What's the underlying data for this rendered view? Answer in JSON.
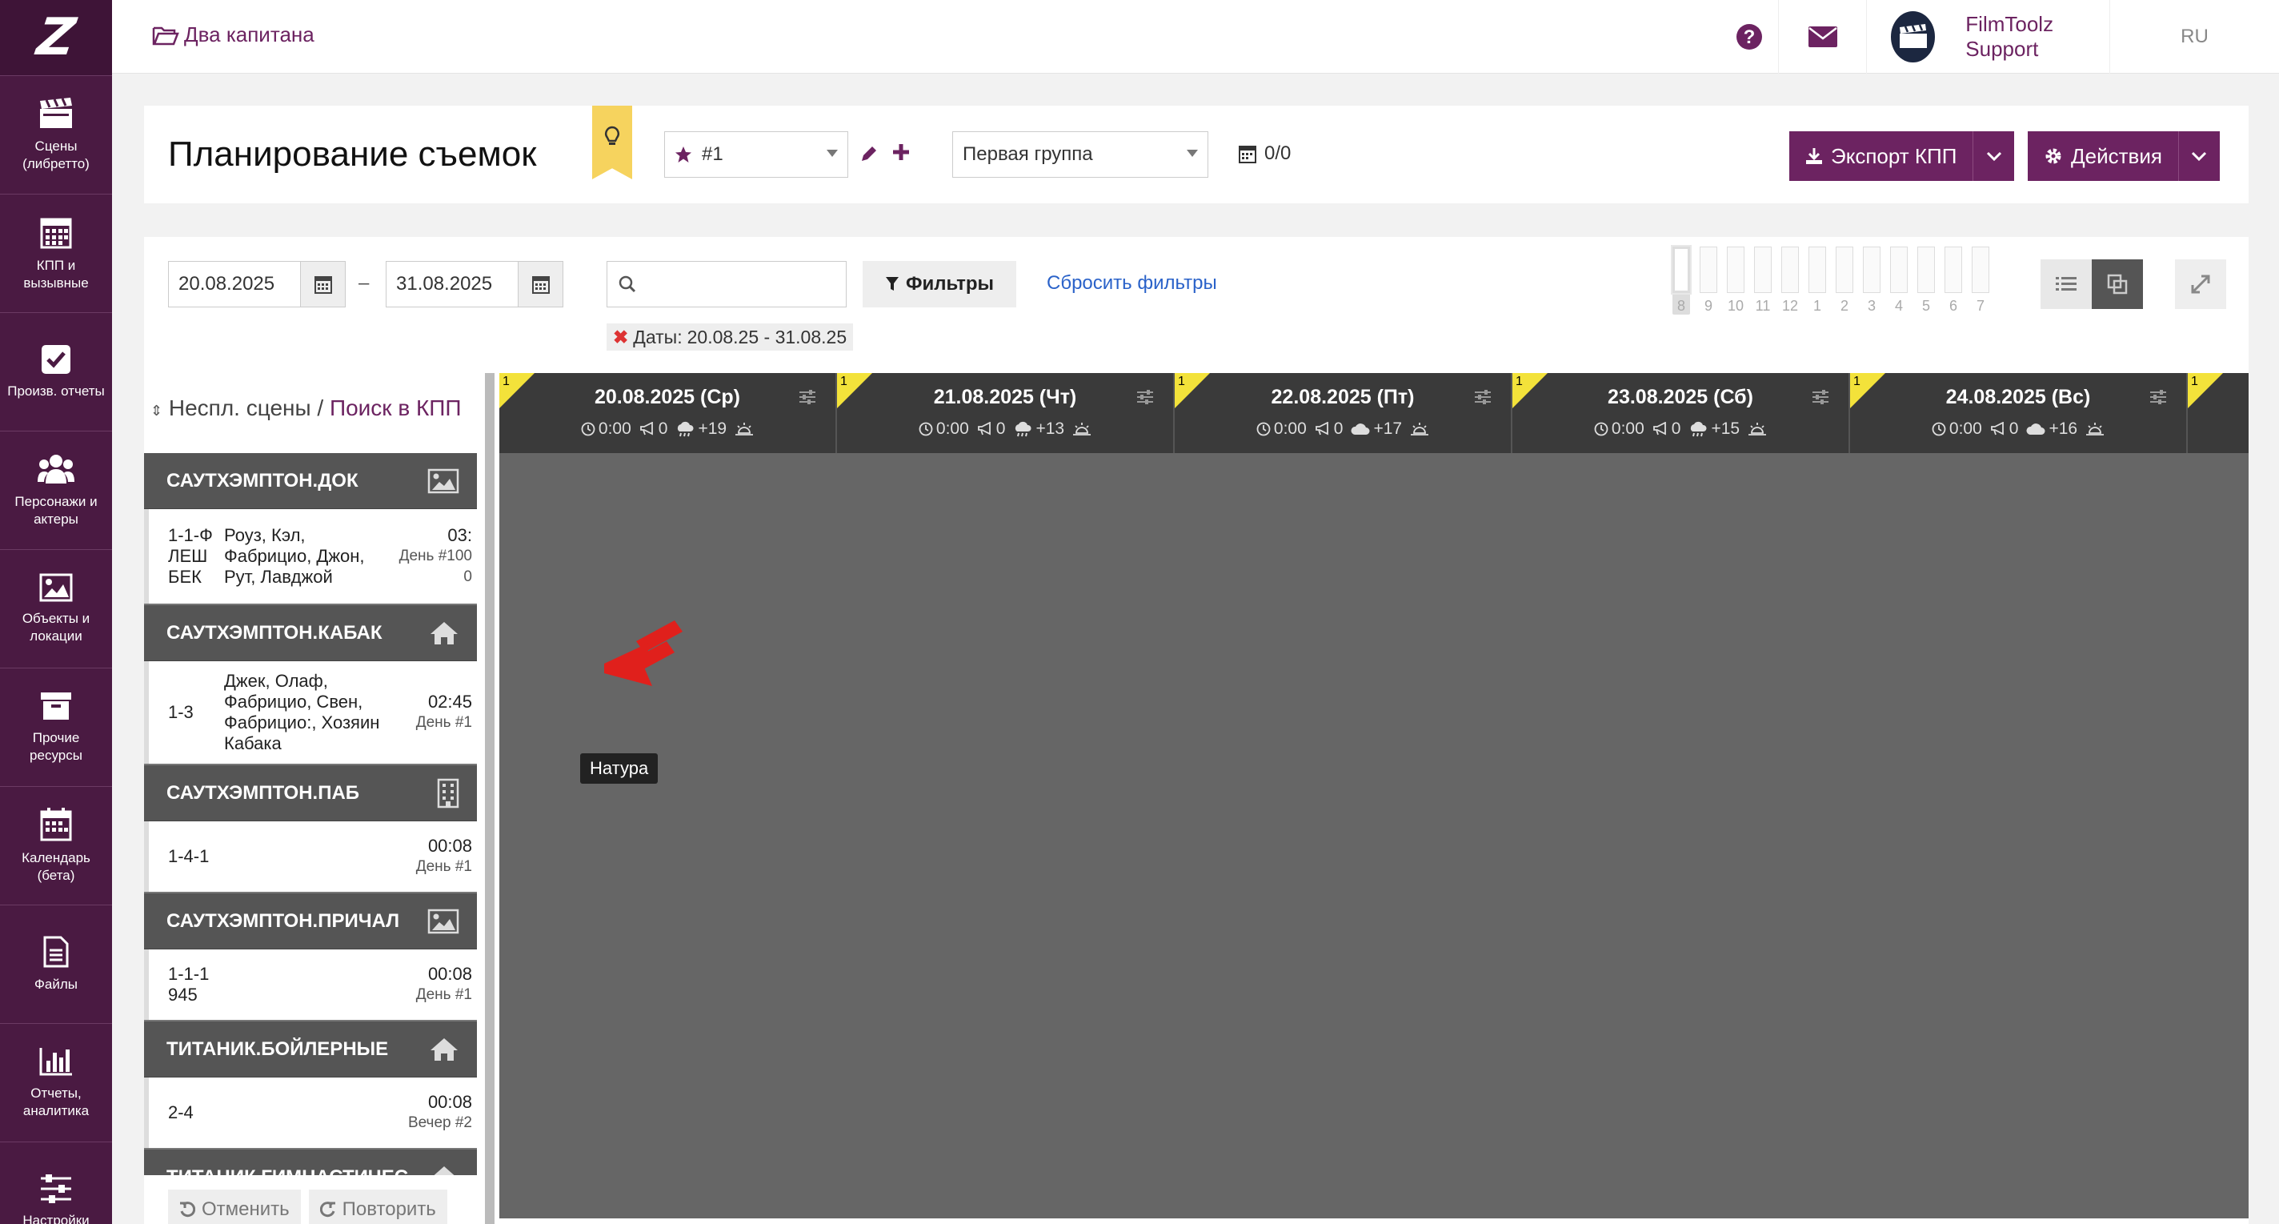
{
  "app": {
    "logo": "Z"
  },
  "sidebar": {
    "items": [
      {
        "label": "Сцены\n(либретто)",
        "icon": "clapperboard-icon"
      },
      {
        "label": "КПП и\nвызывные",
        "icon": "calendar-grid-icon"
      },
      {
        "label": "Произв. отчеты",
        "icon": "checkbox-icon"
      },
      {
        "label": "Персонажи и\nактеры",
        "icon": "users-icon"
      },
      {
        "label": "Объекты и\nлокации",
        "icon": "image-icon"
      },
      {
        "label": "Прочие\nресурсы",
        "icon": "archive-icon"
      },
      {
        "label": "Календарь\n(бета)",
        "icon": "calendar-icon"
      },
      {
        "label": "Файлы",
        "icon": "file-icon"
      },
      {
        "label": "Отчеты,\nаналитика",
        "icon": "bar-chart-icon"
      },
      {
        "label": "Настройки",
        "icon": "sliders-icon"
      }
    ]
  },
  "topbar": {
    "project": "Два капитана",
    "user": "FilmToolz Support",
    "lang": "RU"
  },
  "header": {
    "title": "Планирование съемок",
    "version_select": "#1",
    "group_select": "Первая группа",
    "kpp_count": "0/0",
    "export_label": "Экспорт КПП",
    "actions_label": "Действия"
  },
  "filters": {
    "date_from": "20.08.2025",
    "date_to": "31.08.2025",
    "dash": "–",
    "search_placeholder": "",
    "filters_label": "Фильтры",
    "reset_label": "Сбросить фильтры",
    "chip_label": "Даты:",
    "chip_value": "20.08.25 - 31.08.25",
    "slots": [
      "8",
      "9",
      "10",
      "11",
      "12",
      "1",
      "2",
      "3",
      "4",
      "5",
      "6",
      "7"
    ]
  },
  "left": {
    "heading_a": "Неспл. сцены",
    "sep": "/",
    "heading_b": "Поиск в КПП",
    "tooltip": "Натура",
    "undo": "Отменить",
    "redo": "Повторить",
    "groups": [
      {
        "name": "САУТХЭМПТОН.ДОК",
        "icon": "image-icon",
        "scenes": [
          {
            "num": "1-1-Ф ЛЕШ БЕК",
            "chars": "Роуз, Кэл, Фабрицио, Джон, Рут, Лавджой",
            "time": "03:",
            "day": "День #100 0"
          }
        ]
      },
      {
        "name": "САУТХЭМПТОН.КАБАК",
        "icon": "house-icon",
        "scenes": [
          {
            "num": "1-3",
            "chars": "Джек, Олаф, Фабрицио, Свен, Фабрицио:, Хозяин Кабака",
            "time": "02:45",
            "day": "День #1"
          }
        ]
      },
      {
        "name": "САУТХЭМПТОН.ПАБ",
        "icon": "building-icon",
        "scenes": [
          {
            "num": "1-4-1",
            "chars": "",
            "time": "00:08",
            "day": "День #1"
          }
        ]
      },
      {
        "name": "САУТХЭМПТОН.ПРИЧАЛ",
        "icon": "image-icon",
        "scenes": [
          {
            "num": "1-1-1 945",
            "chars": "",
            "time": "00:08",
            "day": "День #1"
          }
        ]
      },
      {
        "name": "ТИТАНИК.БОЙЛЕРНЫЕ",
        "icon": "house-icon",
        "scenes": [
          {
            "num": "2-4",
            "chars": "",
            "time": "00:08",
            "day": "Вечер #2"
          }
        ]
      },
      {
        "name": "ТИТАНИК.ГИМНАСТИЧЕС",
        "icon": "house-icon",
        "scenes": []
      }
    ]
  },
  "calendar": {
    "days": [
      {
        "flag": "1",
        "date": "20.08.2025 (Ср)",
        "time": "0:00",
        "shots": "0",
        "temp": "+19",
        "weather": "rain-cloud-icon"
      },
      {
        "flag": "1",
        "date": "21.08.2025 (Чт)",
        "time": "0:00",
        "shots": "0",
        "temp": "+13",
        "weather": "rain-cloud-icon"
      },
      {
        "flag": "1",
        "date": "22.08.2025 (Пт)",
        "time": "0:00",
        "shots": "0",
        "temp": "+17",
        "weather": "cloud-icon"
      },
      {
        "flag": "1",
        "date": "23.08.2025 (Сб)",
        "time": "0:00",
        "shots": "0",
        "temp": "+15",
        "weather": "rain-cloud-icon"
      },
      {
        "flag": "1",
        "date": "24.08.2025 (Вс)",
        "time": "0:00",
        "shots": "0",
        "temp": "+16",
        "weather": "cloud-icon"
      },
      {
        "flag": "1",
        "date": "",
        "time": "",
        "shots": "",
        "temp": "",
        "weather": ""
      }
    ]
  },
  "colors": {
    "brand": "#6c2361",
    "sidebar": "#4a1a42",
    "flag": "#f3e23a",
    "arrow": "#e0201c"
  }
}
